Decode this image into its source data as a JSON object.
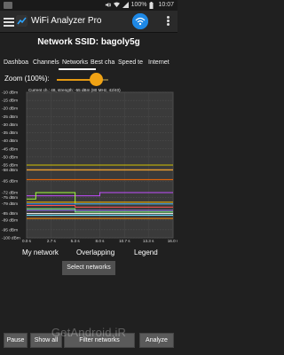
{
  "status_bar": {
    "battery_percent": "100%",
    "time": "10:07"
  },
  "app_bar": {
    "title": "WiFi Analyzer Pro"
  },
  "header": {
    "ssid_label": "Network SSID: bagoly5g"
  },
  "tabs": [
    {
      "label": "Dashboa"
    },
    {
      "label": "Channels"
    },
    {
      "label": "Networks"
    },
    {
      "label": "Best cha"
    },
    {
      "label": "Speed te"
    },
    {
      "label": "Internet"
    }
  ],
  "zoom": {
    "label": "Zoom (100%):",
    "value": 0.72
  },
  "chart_data": {
    "type": "line",
    "title": "Current ch.: 48, strength: -55 dBm (80 MHz, 42/40)",
    "ylabels": [
      "-10 dBm",
      "-15 dBm",
      "-20 dBm",
      "-25 dBm",
      "-30 dBm",
      "-35 dBm",
      "-40 dBm",
      "-45 dBm",
      "-50 dBm",
      "-55 dBm",
      "-58 dBm",
      "-65 dBm",
      "-72 dBm",
      "-75 dBm",
      "-79 dBm",
      "-85 dBm",
      "-89 dBm",
      "-95 dBm",
      "-100 dBm"
    ],
    "xlabels": [
      "0.0 s",
      "2.7 s",
      "5.3 s",
      "8.0 s",
      "10.7 s",
      "13.3 s",
      "16.0 s"
    ],
    "ylim": [
      -100,
      -10
    ],
    "xlim": [
      0,
      16
    ],
    "series": [
      {
        "color": "#f0a030",
        "points": [
          [
            0,
            -58
          ],
          [
            16,
            -58
          ]
        ]
      },
      {
        "color": "#d2c300",
        "points": [
          [
            0,
            -55
          ],
          [
            16,
            -55
          ]
        ]
      },
      {
        "color": "#ff6a00",
        "points": [
          [
            0,
            -64
          ],
          [
            16,
            -64
          ]
        ]
      },
      {
        "color": "#c34dff",
        "points": [
          [
            0,
            -74
          ],
          [
            8,
            -74
          ],
          [
            8,
            -72
          ],
          [
            16,
            -72
          ]
        ]
      },
      {
        "color": "#a3ff3a",
        "points": [
          [
            0,
            -76
          ],
          [
            1,
            -76
          ],
          [
            1,
            -72
          ],
          [
            5.3,
            -72
          ],
          [
            5.3,
            -79
          ],
          [
            16,
            -79
          ]
        ]
      },
      {
        "color": "#2f8cff",
        "points": [
          [
            0,
            -79
          ],
          [
            16,
            -79
          ]
        ]
      },
      {
        "color": "#ff4e4e",
        "points": [
          [
            0,
            -80
          ],
          [
            5.3,
            -80
          ],
          [
            5.3,
            -81
          ],
          [
            16,
            -81
          ]
        ]
      },
      {
        "color": "#ff4fd1",
        "points": [
          [
            0,
            -83
          ],
          [
            16,
            -83
          ]
        ]
      },
      {
        "color": "#ffffff",
        "points": [
          [
            0,
            -85
          ],
          [
            16,
            -85
          ]
        ]
      },
      {
        "color": "#66e3ff",
        "points": [
          [
            0,
            -86
          ],
          [
            16,
            -86
          ]
        ]
      },
      {
        "color": "#ff8a00",
        "points": [
          [
            0,
            -88
          ],
          [
            16,
            -88
          ]
        ]
      },
      {
        "color": "#7cff7c",
        "points": [
          [
            0,
            -82
          ],
          [
            5.3,
            -82
          ],
          [
            5.3,
            -84
          ],
          [
            16,
            -84
          ]
        ]
      },
      {
        "color": "#ffbf00",
        "points": [
          [
            0,
            -78
          ],
          [
            16,
            -78
          ]
        ]
      },
      {
        "color": "#9b7bff",
        "points": [
          [
            0,
            -83
          ],
          [
            16,
            -83
          ]
        ]
      }
    ]
  },
  "legend_labels": [
    "My network",
    "Overlapping",
    "Legend"
  ],
  "select_networks_label": "Select networks",
  "bottom_bar": {
    "buttons": [
      "Pause",
      "Show all",
      "Filter networks",
      "Analyze"
    ]
  },
  "watermark": "GetAndroid.iR"
}
